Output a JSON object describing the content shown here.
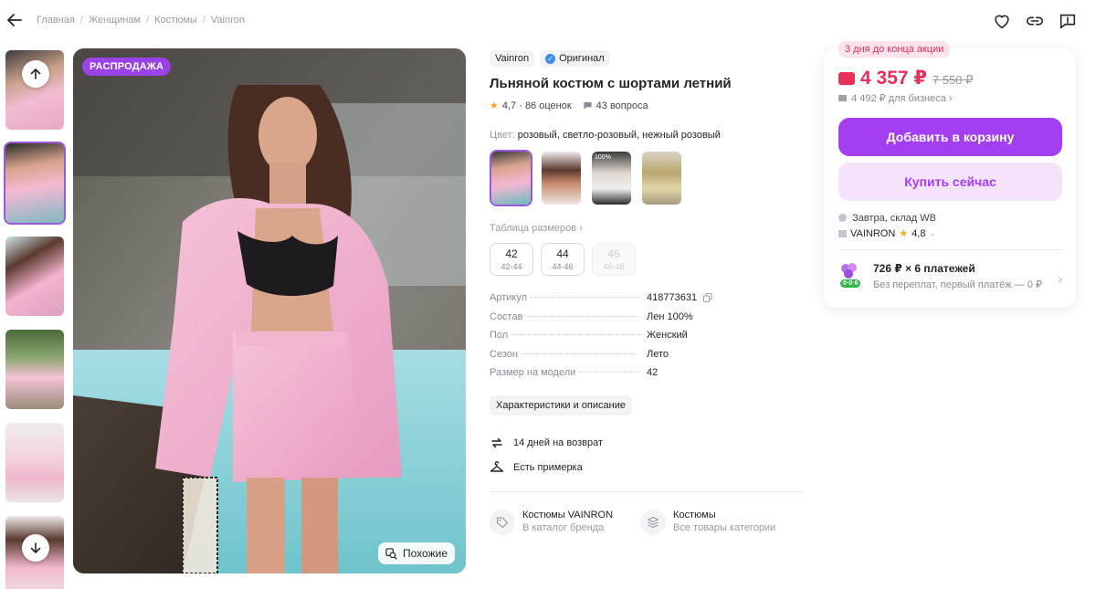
{
  "breadcrumb": [
    "Главная",
    "Женщинам",
    "Костюмы",
    "Vainron"
  ],
  "icons": {
    "back": "arrow-left-icon",
    "favorite": "heart-icon",
    "share": "link-icon",
    "report": "report-icon"
  },
  "gallery": {
    "sale_badge": "РАСПРОДАЖА",
    "similar_label": "Похожие",
    "thumbnail_count": 6,
    "active_thumbnail": 2
  },
  "product": {
    "brand": "Vainron",
    "original_label": "Оригинал",
    "title": "Льняной костюм с шортами летний",
    "rating": "4,7 · 86 оценок",
    "questions": "43 вопроса",
    "color_key": "Цвет:",
    "color_value": "розовый, светло-розовый, нежный розовый",
    "swatch_count": 4,
    "swatch_badge": "100%",
    "size_table_label": "Таблица размеров",
    "sizes": [
      {
        "n": "42",
        "r": "42-44",
        "available": true
      },
      {
        "n": "44",
        "r": "44-46",
        "available": true
      },
      {
        "n": "46",
        "r": "46-48",
        "available": false
      }
    ],
    "specs": [
      {
        "k": "Артикул",
        "v": "418773631"
      },
      {
        "k": "Состав",
        "v": "Лен 100%"
      },
      {
        "k": "Пол",
        "v": "Женский"
      },
      {
        "k": "Сезон",
        "v": "Лето"
      },
      {
        "k": "Размер на модели",
        "v": "42"
      }
    ],
    "chars_button": "Характеристики и описание",
    "features": [
      "14 дней на возврат",
      "Есть примерка"
    ],
    "categories": [
      {
        "t1": "Костюмы VAINRON",
        "t2": "В каталог бренда"
      },
      {
        "t1": "Костюмы",
        "t2": "Все товары категории"
      }
    ]
  },
  "buy": {
    "promo": "3 дня до конца акции",
    "price": "4 357 ₽",
    "old_price": "7 550 ₽",
    "business": "4 492 ₽ для бизнеса ›",
    "add_to_cart": "Добавить в корзину",
    "buy_now": "Купить сейчас",
    "delivery": "Завтра, склад WB",
    "seller": "VAINRON",
    "seller_rating": "4,8",
    "installment_title": "726 ₽ × 6 платежей",
    "installment_sub": "Без переплат, первый платёж — 0 ₽",
    "installment_badge": "0·0·6"
  },
  "colors": {
    "accent": "#a33ff0",
    "price": "#e6325a",
    "sale_badge": "#9a42e6"
  }
}
